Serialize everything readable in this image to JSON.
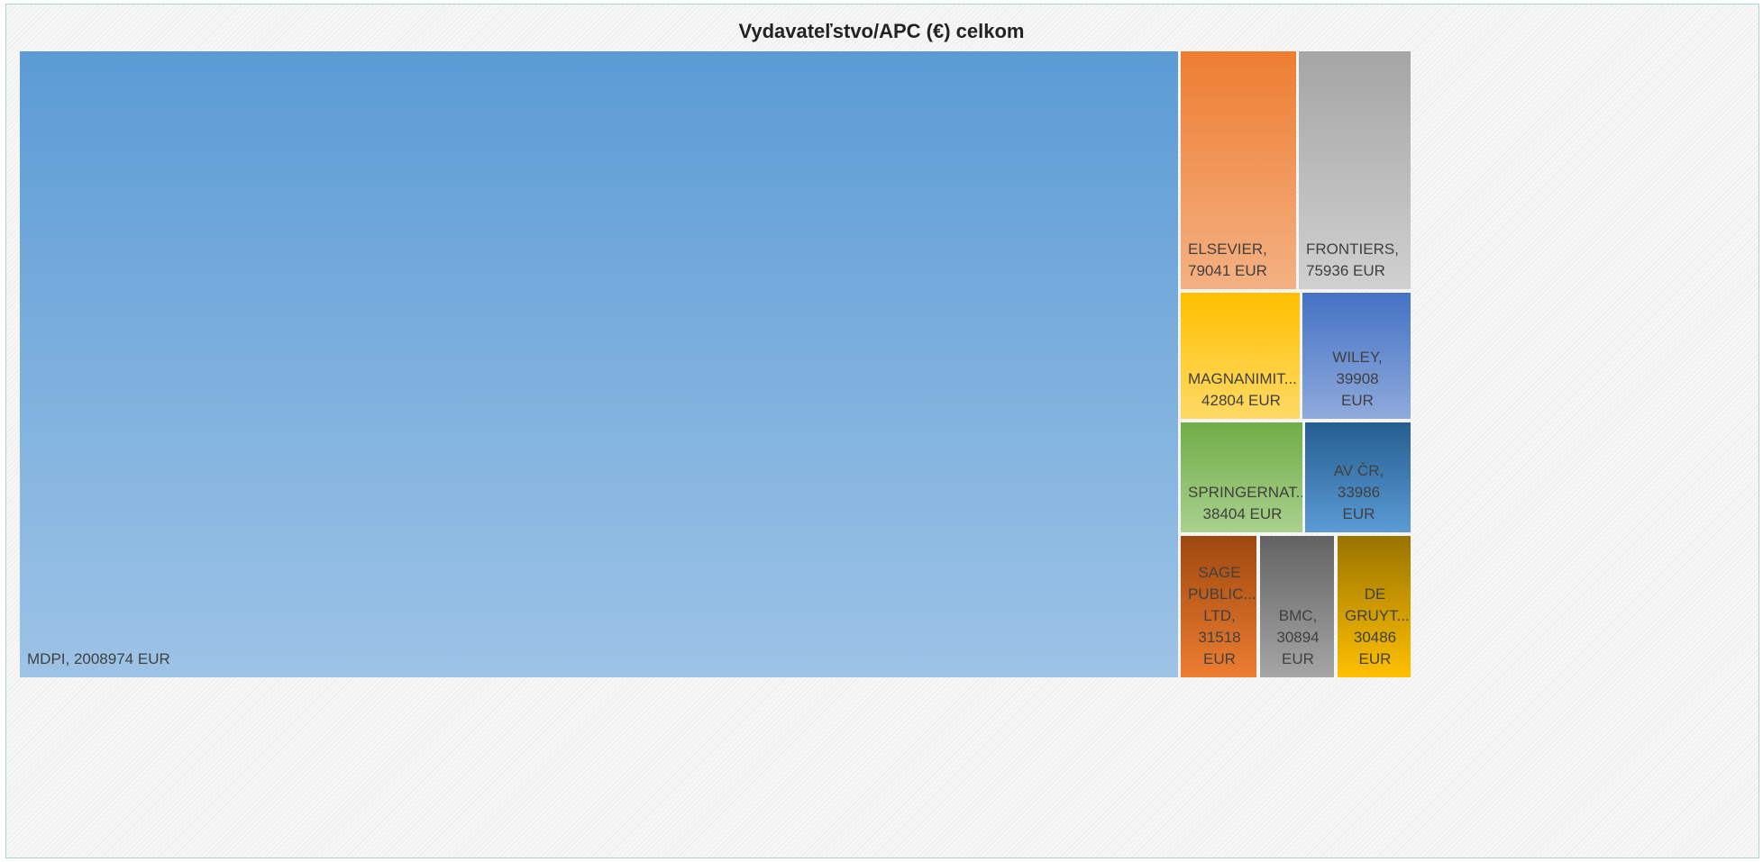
{
  "chart_data": {
    "type": "treemap",
    "title": "Vydavateľstvo/APC (€) celkom",
    "items": [
      {
        "name": "MDPI",
        "value": 2008974,
        "label": "MDPI, 2008974 EUR",
        "color_top": "#5b9bd5",
        "color_bottom": "#9dc3e6"
      },
      {
        "name": "ELSEVIER",
        "value": 79041,
        "label": "ELSEVIER,\n79041 EUR",
        "color_top": "#ed7d31",
        "color_bottom": "#f4b183"
      },
      {
        "name": "FRONTIERS",
        "value": 75936,
        "label": "FRONTIERS,\n75936 EUR",
        "color_top": "#a5a5a5",
        "color_bottom": "#d0d0d0"
      },
      {
        "name": "MAGNANIMIT...",
        "value": 42804,
        "label": "MAGNANIMIT...\n42804 EUR",
        "color_top": "#ffc000",
        "color_bottom": "#ffd966"
      },
      {
        "name": "WILEY",
        "value": 39908,
        "label": "WILEY, 39908\nEUR",
        "color_top": "#4472c4",
        "color_bottom": "#8faadc"
      },
      {
        "name": "SPRINGERNAT...",
        "value": 38404,
        "label": "SPRINGERNAT...\n38404 EUR",
        "color_top": "#70ad47",
        "color_bottom": "#a9d18e"
      },
      {
        "name": "AV ČR",
        "value": 33986,
        "label": "AV ČR, 33986\nEUR",
        "color_top": "#255e91",
        "color_bottom": "#5b9bd5"
      },
      {
        "name": "SAGE PUBLIC... LTD",
        "value": 31518,
        "label": "SAGE\nPUBLIC...\nLTD,\n31518\nEUR",
        "color_top": "#9e480e",
        "color_bottom": "#ed7d31"
      },
      {
        "name": "BMC",
        "value": 30894,
        "label": "BMC,\n30894\nEUR",
        "color_top": "#636363",
        "color_bottom": "#a5a5a5"
      },
      {
        "name": "DE GRUYT...",
        "value": 30486,
        "label": "DE\nGRUYT...\n30486\nEUR",
        "color_top": "#997300",
        "color_bottom": "#ffc000"
      }
    ]
  }
}
